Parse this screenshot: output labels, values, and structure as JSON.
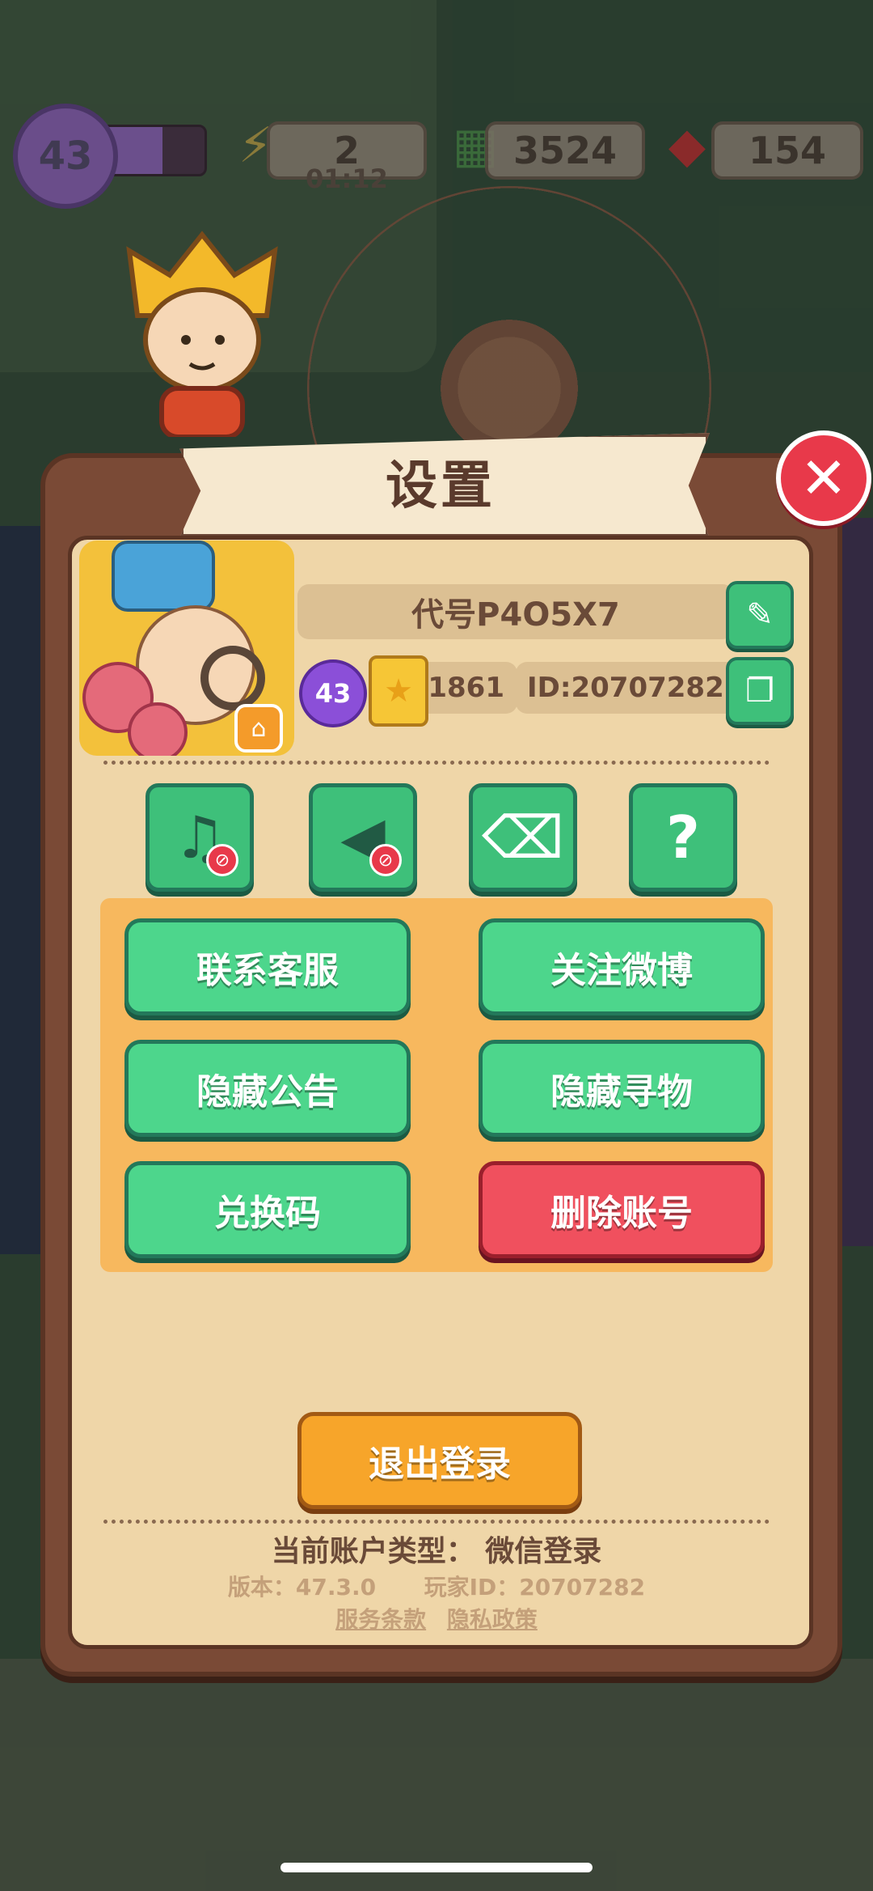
{
  "hud": {
    "level": "43",
    "xp_progress": 0.6,
    "energy": "2",
    "energy_timer": "01:12",
    "cash": "3524",
    "gems": "154"
  },
  "dialog": {
    "title": "设置",
    "close_label": "✕"
  },
  "profile": {
    "name": "代号P4O5X7",
    "level": "43",
    "stars": "1861",
    "id": "ID:20707282"
  },
  "buttons": {
    "contact_support": "联系客服",
    "follow_weibo": "关注微博",
    "hide_announcement": "隐藏公告",
    "hide_search": "隐藏寻物",
    "redeem_code": "兑换码",
    "delete_account": "删除账号",
    "logout": "退出登录"
  },
  "footer": {
    "account_type": "当前账户类型： 微信登录",
    "version": "版本：47.3.0",
    "player_id": "玩家ID：20707282",
    "terms": "服务条款",
    "privacy": "隐私政策"
  },
  "colors": {
    "primary_green": "#4dd68c",
    "danger_red": "#f0505e",
    "accent_orange": "#f7a52a",
    "panel_brown": "#7a4a36",
    "panel_cream": "#efd6a8"
  }
}
